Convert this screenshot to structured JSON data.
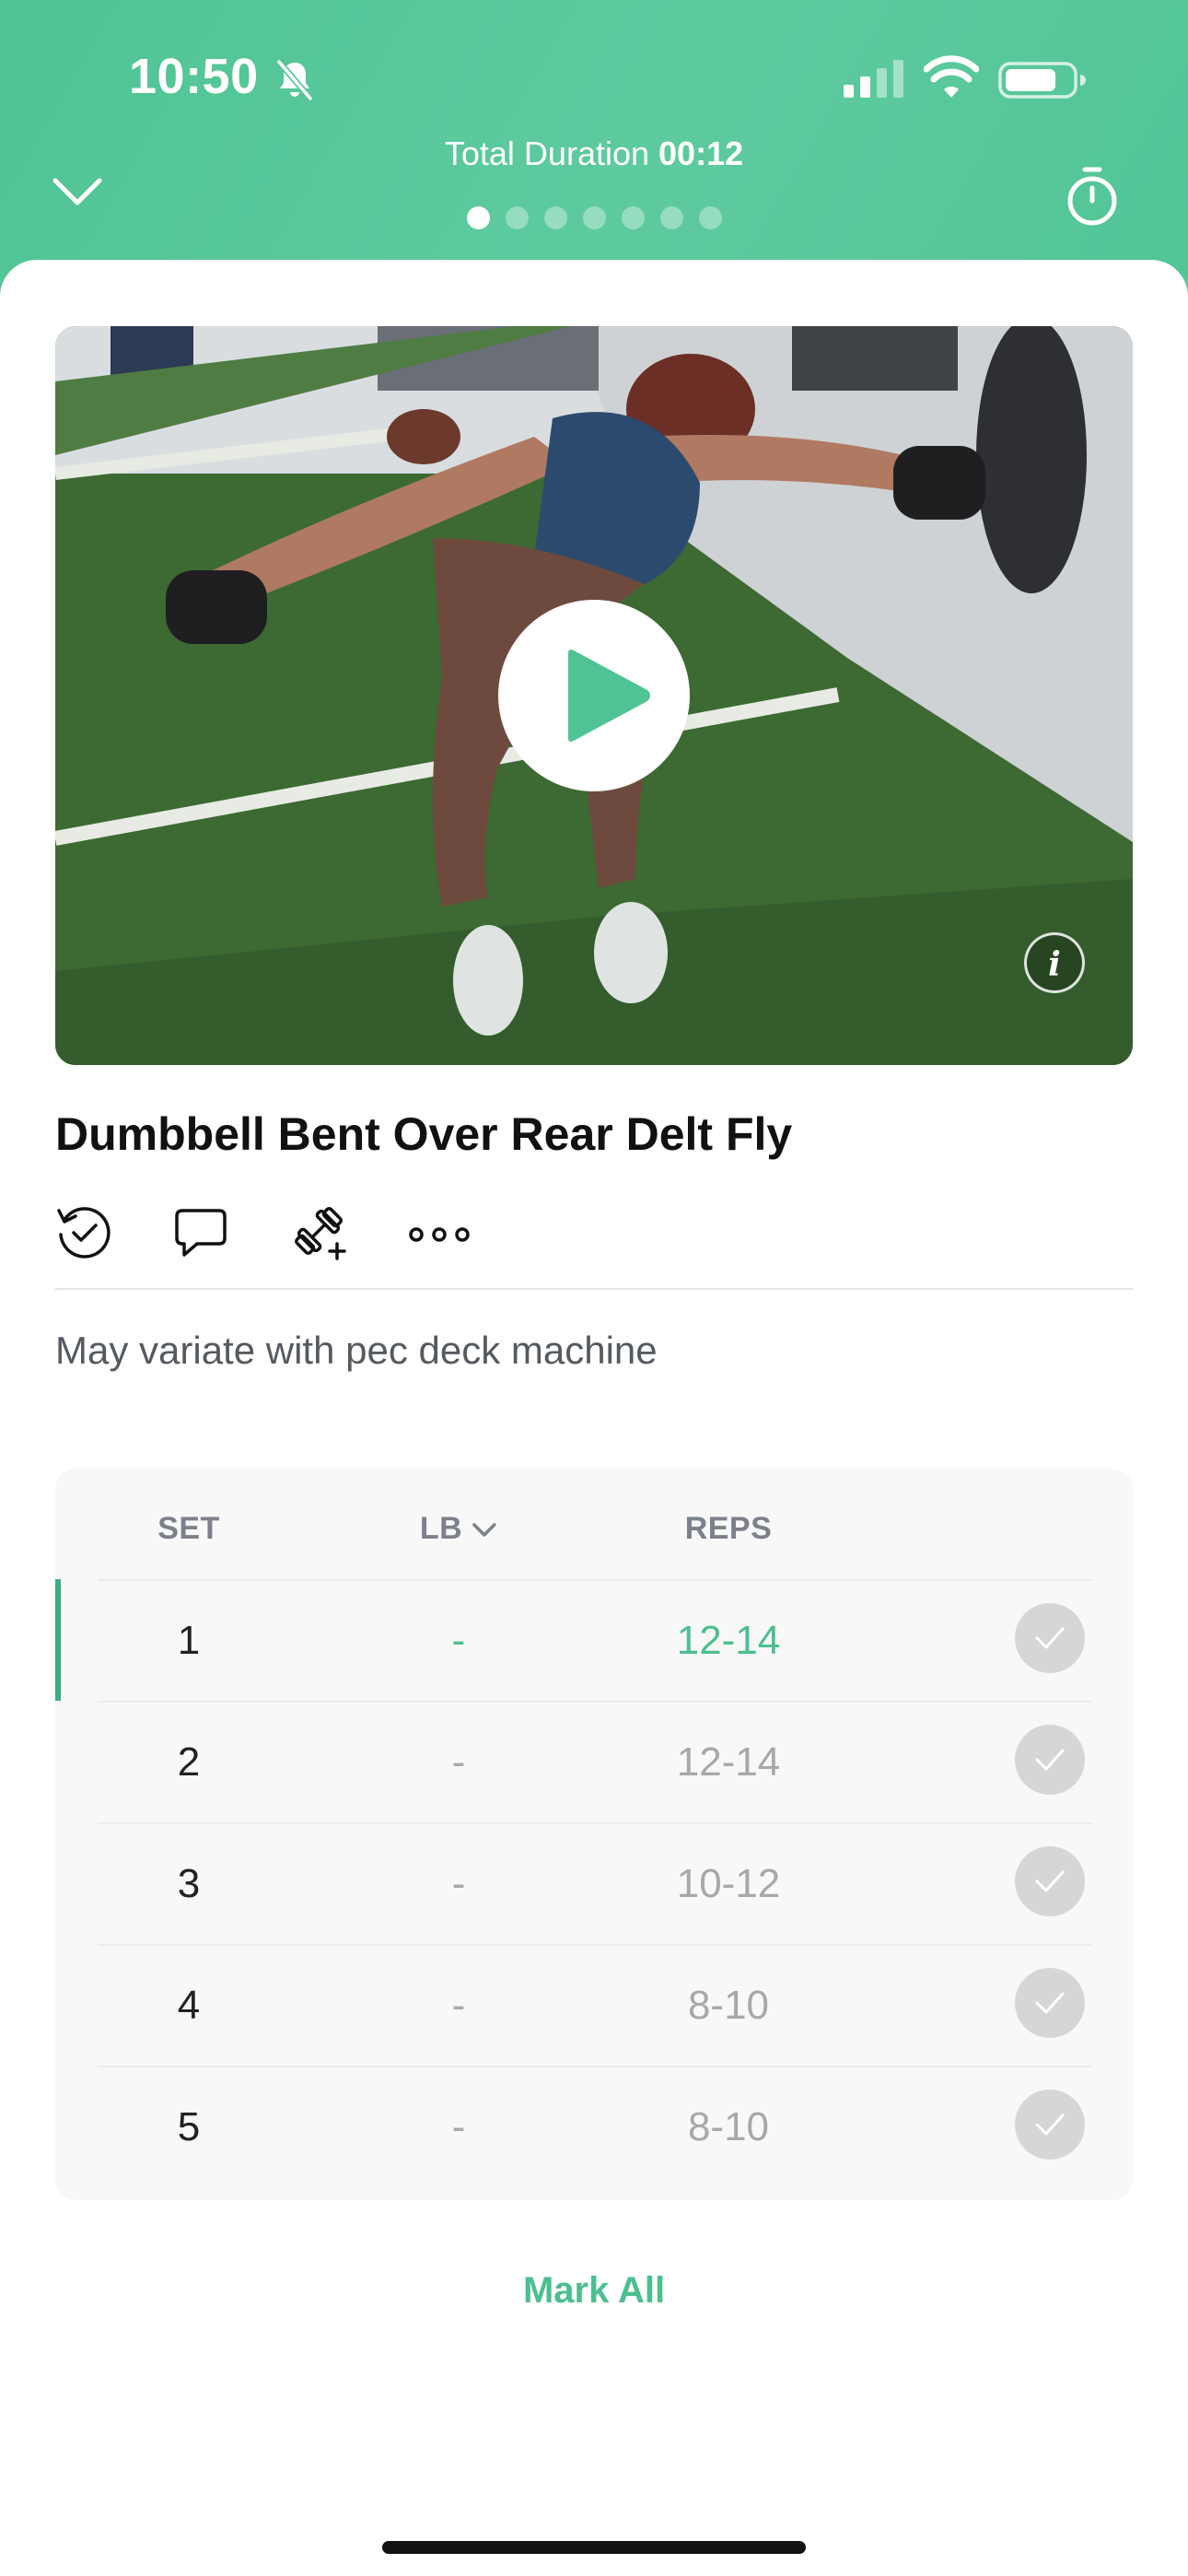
{
  "status_bar": {
    "time": "10:50",
    "icons": [
      "bell-slash-icon",
      "cellular-signal-icon",
      "wifi-icon",
      "battery-icon"
    ]
  },
  "header": {
    "duration_label": "Total Duration",
    "duration_value": "00:12",
    "page_dots": 7,
    "active_dot": 1,
    "accent_color": "#57c79a"
  },
  "exercise": {
    "video_thumbnail": "Dumbbell bent over rear delt fly demonstration",
    "title": "Dumbbell Bent Over Rear Delt Fly",
    "tools": [
      "history-icon",
      "comment-icon",
      "dumbbell-add-icon",
      "more-icon"
    ],
    "note": "May variate with pec deck machine"
  },
  "sets_table": {
    "headers": {
      "set": "SET",
      "weight": "LB",
      "reps": "REPS"
    },
    "rows": [
      {
        "set": "1",
        "weight": "-",
        "reps": "12-14",
        "current": true
      },
      {
        "set": "2",
        "weight": "-",
        "reps": "12-14",
        "current": false
      },
      {
        "set": "3",
        "weight": "-",
        "reps": "10-12",
        "current": false
      },
      {
        "set": "4",
        "weight": "-",
        "reps": "8-10",
        "current": false
      },
      {
        "set": "5",
        "weight": "-",
        "reps": "8-10",
        "current": false
      }
    ]
  },
  "mark_all_label": "Mark All"
}
